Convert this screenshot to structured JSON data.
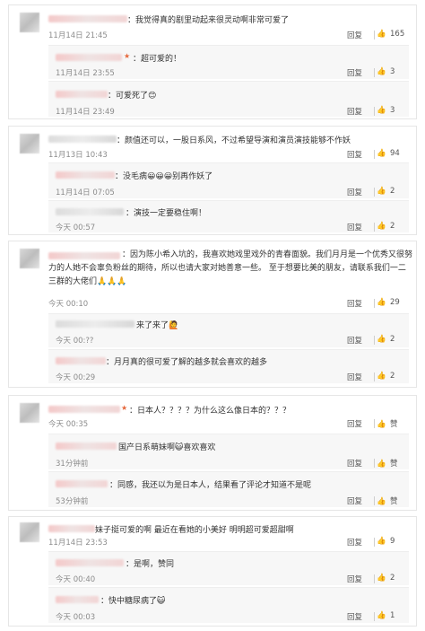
{
  "comments": [
    {
      "text": "：我觉得真的剧里动起来很灵动啊非常可爱了",
      "time": "11月14日 21:45",
      "reply_label": "回复",
      "likes": "165",
      "replies": [
        {
          "text": "：超可爱的！",
          "time": "11月14日 23:55",
          "reply_label": "回复",
          "likes": "3"
        },
        {
          "text": "：可爱死了😊",
          "time": "11月14日 23:49",
          "reply_label": "回复",
          "likes": "3"
        }
      ]
    },
    {
      "text": "：颜值还可以，一股日系风，不过希望导演和演员演技能够不作妖",
      "time": "11月13日 10:43",
      "reply_label": "回复",
      "likes": "94",
      "replies": [
        {
          "text": "：没毛病😀😀😀别再作妖了",
          "time": "11月14日 07:05",
          "reply_label": "回复",
          "likes": "2"
        },
        {
          "text": "：演技一定要稳住啊！",
          "time": "今天 00:57",
          "reply_label": "回复",
          "likes": "2"
        }
      ]
    },
    {
      "text": "：因为陈小希入坑的，我喜欢她戏里戏外的青春面貌。我们月月是一个优秀又很努力的人她不会辜负粉丝的期待，所以也请大家对她善意一些。   至于想要比美的朋友，请联系我们一二三群的大佬们🙏🙏🙏",
      "time": "今天 00:10",
      "reply_label": "回复",
      "likes": "29",
      "replies": [
        {
          "text": "来了来了🙋",
          "time": "今天 00:??",
          "reply_label": "回复",
          "likes": "2"
        },
        {
          "text": "：月月真的很可爱了解的越多就会喜欢的越多",
          "time": "今天 00:29",
          "reply_label": "回复",
          "likes": "2"
        }
      ]
    },
    {
      "text": "：日本人？？？？为什么这么像日本的？？？",
      "time": "今天 00:35",
      "reply_label": "回复",
      "likes": "赞",
      "replies": [
        {
          "text": "国产日系萌妹啊😺喜欢喜欢",
          "time": "31分钟前",
          "reply_label": "回复",
          "likes": "赞"
        },
        {
          "text": "：同感，我还以为是日本人，结果看了评论才知道不是呢",
          "time": "53分钟前",
          "reply_label": "回复",
          "likes": "赞"
        }
      ]
    },
    {
      "text": "妹子挺可爱的啊 最近在看她的小美好 明明超可爱超甜啊",
      "time": "11月14日 23:53",
      "reply_label": "回复",
      "likes": "9",
      "replies": [
        {
          "text": "：是啊，赞同",
          "time": "今天 00:40",
          "reply_label": "回复",
          "likes": "2"
        },
        {
          "text": "：快中糖尿病了😺",
          "time": "今天 00:03",
          "reply_label": "回复",
          "likes": "1"
        }
      ]
    }
  ],
  "icons": {
    "like": "thumbs-up-icon",
    "vip": "crown-icon"
  },
  "colors": {
    "name_blur": "#f2d0d0",
    "border": "#e6e6e6",
    "sub_bg": "#f7f7f7",
    "muted": "#8c8c8c"
  }
}
